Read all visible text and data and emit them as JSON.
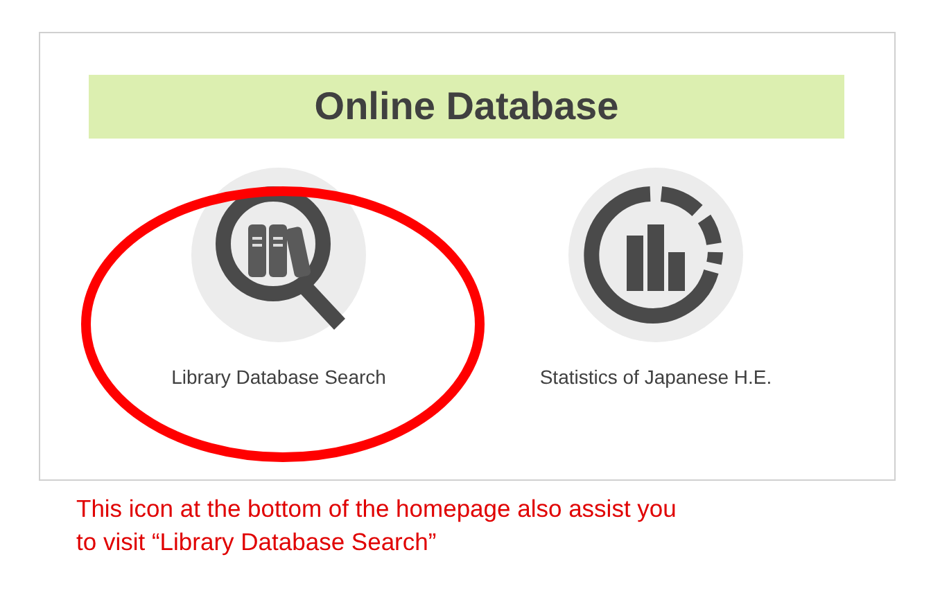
{
  "panel": {
    "title": "Online Database",
    "links": [
      {
        "kind": "library",
        "label": "Library Database Search",
        "highlighted": true
      },
      {
        "kind": "statistics",
        "label": "Statistics of Japanese H.E.",
        "highlighted": false
      }
    ]
  },
  "note": {
    "lines": [
      "This icon at the bottom of the homepage also assist you",
      "to visit “Library Database Search”"
    ]
  }
}
